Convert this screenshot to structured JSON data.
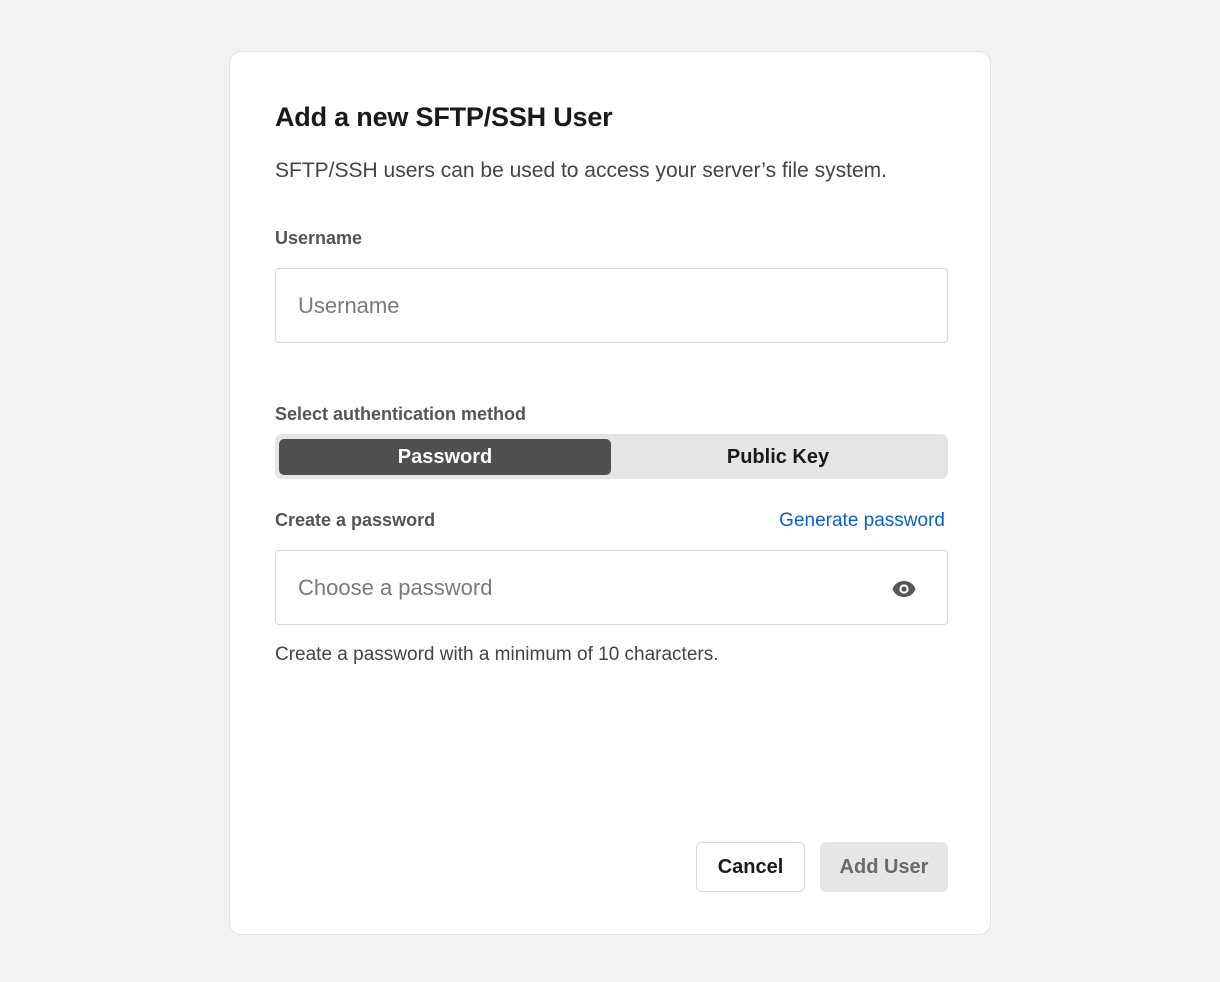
{
  "dialog": {
    "title": "Add a new SFTP/SSH User",
    "subtitle": "SFTP/SSH users can be used to access your server’s file system."
  },
  "username": {
    "label": "Username",
    "placeholder": "Username",
    "value": ""
  },
  "auth": {
    "label": "Select authentication method",
    "options": [
      "Password",
      "Public Key"
    ],
    "selected": "Password"
  },
  "password": {
    "label": "Create a password",
    "generate_label": "Generate password",
    "placeholder": "Choose a password",
    "value": "",
    "hint": "Create a password with a minimum of 10 characters.",
    "visibility_icon": "eye-icon"
  },
  "actions": {
    "cancel_label": "Cancel",
    "add_label": "Add User"
  },
  "colors": {
    "link": "#0a5fd6",
    "toggle_active": "#505050",
    "button_disabled_bg": "#e6e6e6"
  }
}
